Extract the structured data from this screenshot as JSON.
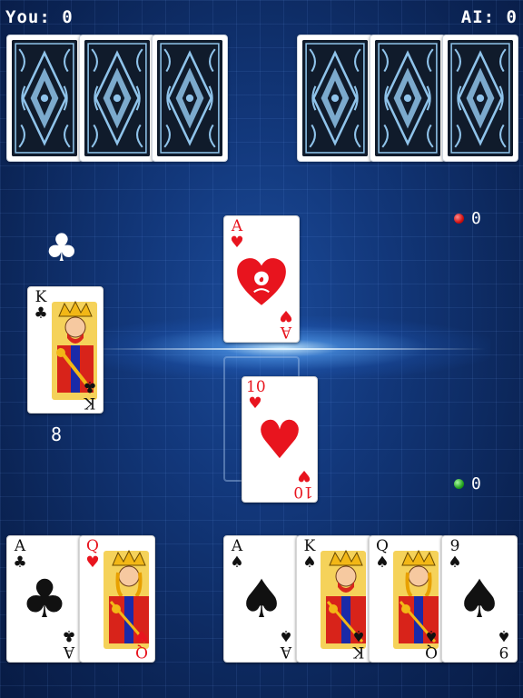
{
  "scores": {
    "you": "You: 0",
    "ai": "AI: 0"
  },
  "opponent_backs": {
    "left_count": 3,
    "right_count": 3
  },
  "lead_suit": "♣",
  "left_pile_count": "8",
  "indicators": {
    "top": "0",
    "bottom": "0"
  },
  "cards": {
    "left_pile_top": {
      "rank": "K",
      "suit": "♣",
      "color": "black"
    },
    "trick_top": {
      "rank": "A",
      "suit": "♥",
      "color": "red"
    },
    "trick_bottom": {
      "rank": "10",
      "suit": "♥",
      "color": "red"
    },
    "hand_left": [
      {
        "rank": "A",
        "suit": "♣",
        "color": "black"
      },
      {
        "rank": "Q",
        "suit": "♥",
        "color": "red"
      }
    ],
    "hand_right": [
      {
        "rank": "A",
        "suit": "♠",
        "color": "black"
      },
      {
        "rank": "K",
        "suit": "♠",
        "color": "black"
      },
      {
        "rank": "Q",
        "suit": "♠",
        "color": "black"
      },
      {
        "rank": "9",
        "suit": "♠",
        "color": "black"
      }
    ]
  },
  "colors": {
    "accent_red": "#e8141e",
    "table_blue": "#12377a"
  }
}
